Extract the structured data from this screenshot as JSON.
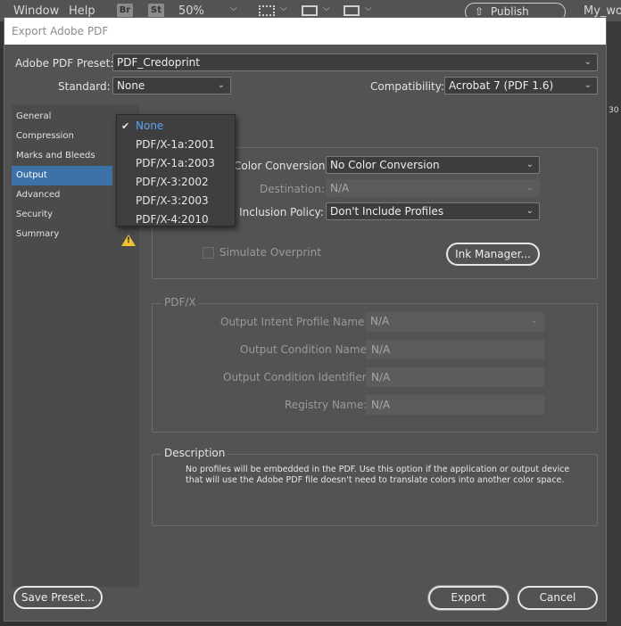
{
  "app_menu": {
    "window": "Window",
    "help": "Help",
    "bridge": "Br",
    "stock": "St",
    "zoom": "50%",
    "publish_online": "Publish Online",
    "doc_name": "My_wor",
    "right_num": "30"
  },
  "dialog": {
    "title": "Export Adobe PDF",
    "preset_label": "Adobe PDF Preset:",
    "preset_value": "PDF_Credoprint",
    "standard_label": "Standard:",
    "standard_value": "None",
    "compat_label": "Compatibility:",
    "compat_value": "Acrobat 7 (PDF 1.6)"
  },
  "sidebar": {
    "items": [
      {
        "label": "General"
      },
      {
        "label": "Compression"
      },
      {
        "label": "Marks and Bleeds"
      },
      {
        "label": "Output"
      },
      {
        "label": "Advanced"
      },
      {
        "label": "Security"
      },
      {
        "label": "Summary"
      }
    ],
    "selected": "Output",
    "warning_icon": "warning-icon"
  },
  "standard_menu": {
    "options": [
      "None",
      "PDF/X-1a:2001",
      "PDF/X-1a:2003",
      "PDF/X-3:2002",
      "PDF/X-3:2003",
      "PDF/X-4:2010"
    ],
    "selected": "None"
  },
  "color": {
    "conversion_label": "Color Conversion:",
    "conversion_value": "No Color Conversion",
    "destination_label": "Destination:",
    "destination_value": "N/A",
    "profile_label": "Profile Inclusion Policy:",
    "profile_value": "Don't Include Profiles",
    "simulate_overprint": "Simulate Overprint",
    "ink_manager": "Ink Manager..."
  },
  "pdfx": {
    "title": "PDF/X",
    "intent_label": "Output Intent Profile Name:",
    "intent_value": "N/A",
    "cond_name_label": "Output Condition Name:",
    "cond_name_value": "N/A",
    "cond_id_label": "Output Condition Identifier:",
    "cond_id_value": "N/A",
    "registry_label": "Registry Name:",
    "registry_value": "N/A"
  },
  "description": {
    "title": "Description",
    "text": "No profiles will be embedded in the PDF. Use this option if the application or output device that will use the Adobe PDF file doesn't need to translate colors into another color space."
  },
  "footer": {
    "save_preset": "Save Preset...",
    "export": "Export",
    "cancel": "Cancel"
  },
  "colors": {
    "selection": "#3d72a8",
    "menu_selected": "#5aa2f0",
    "warning": "#f2c12e"
  }
}
